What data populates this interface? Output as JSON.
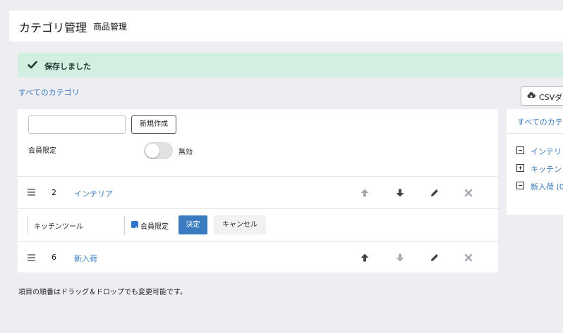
{
  "header": {
    "title": "カテゴリ管理",
    "subtitle": "商品管理"
  },
  "alert": {
    "message": "保存しました"
  },
  "breadcrumb": {
    "all_categories": "すべてのカテゴリ"
  },
  "csv_button": {
    "label": "CSVダ"
  },
  "new_category": {
    "input_value": "",
    "button_label": "新規作成",
    "member_label": "会員限定",
    "toggle_label": "無効",
    "toggle_on": false
  },
  "rows": [
    {
      "number": "2",
      "name": "インテリア",
      "up_enabled": false,
      "down_enabled": true
    },
    {
      "number": "6",
      "name": "新入荷",
      "up_enabled": true,
      "down_enabled": false
    }
  ],
  "edit_row": {
    "input_value": "キッチンツール",
    "checkbox_label": "会員限定",
    "checked": true,
    "confirm_label": "決定",
    "cancel_label": "キャンセル"
  },
  "footnote": "項目の順番はドラッグ＆ドロップでも変更可能です。",
  "sidebar": {
    "header": "すべてのカテ",
    "items": [
      {
        "icon": "minus-box-icon",
        "label": "インテリ"
      },
      {
        "icon": "plus-box-icon",
        "label": "キッチン"
      },
      {
        "icon": "minus-box-icon",
        "label": "新入荷 (0"
      }
    ]
  },
  "colors": {
    "link": "#3b7cc1",
    "alert_bg": "#d2efe2",
    "primary": "#3b7cc1",
    "icon_active": "#444444",
    "icon_muted": "#a7aab0"
  }
}
